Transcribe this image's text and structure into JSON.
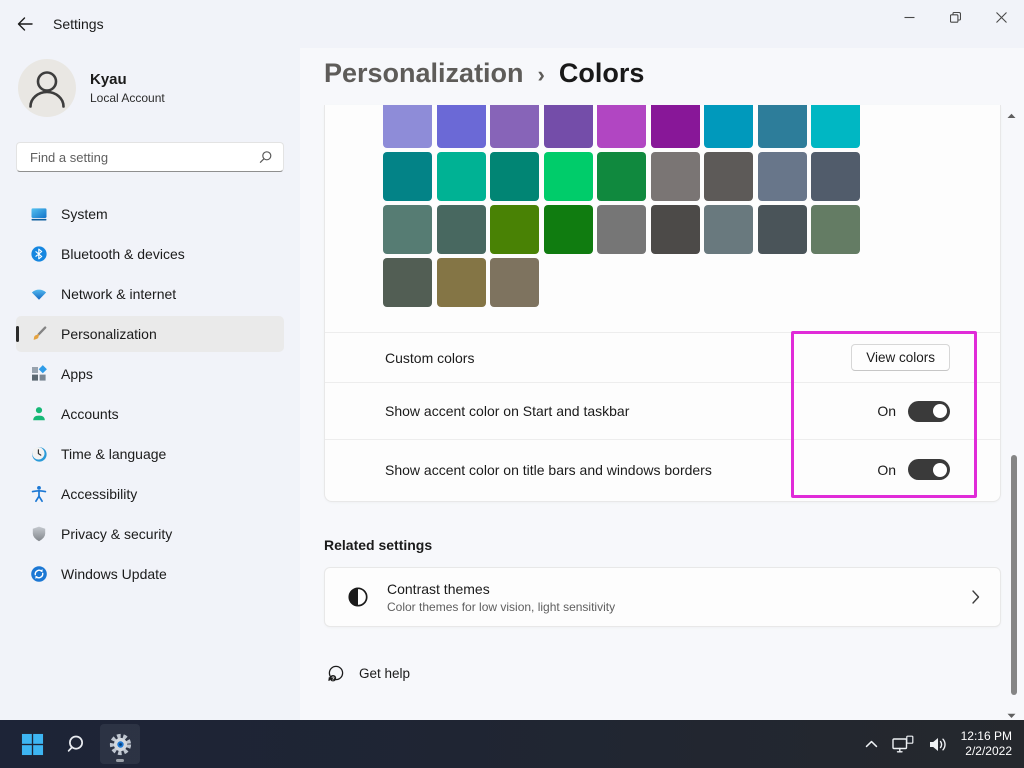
{
  "titlebar": {
    "title": "Settings"
  },
  "sidebar": {
    "user": {
      "name": "Kyau",
      "account_type": "Local Account"
    },
    "search_placeholder": "Find a setting",
    "items": [
      {
        "key": "system",
        "label": "System",
        "selected": false
      },
      {
        "key": "bluetooth",
        "label": "Bluetooth & devices",
        "selected": false
      },
      {
        "key": "network",
        "label": "Network & internet",
        "selected": false
      },
      {
        "key": "personalization",
        "label": "Personalization",
        "selected": true
      },
      {
        "key": "apps",
        "label": "Apps",
        "selected": false
      },
      {
        "key": "accounts",
        "label": "Accounts",
        "selected": false
      },
      {
        "key": "time",
        "label": "Time & language",
        "selected": false
      },
      {
        "key": "accessibility",
        "label": "Accessibility",
        "selected": false
      },
      {
        "key": "privacy",
        "label": "Privacy & security",
        "selected": false
      },
      {
        "key": "update",
        "label": "Windows Update",
        "selected": false
      }
    ]
  },
  "breadcrumb": {
    "parent": "Personalization",
    "separator": "›",
    "current": "Colors"
  },
  "accent_palette": {
    "colors": [
      "#8E8CD8",
      "#6B69D6",
      "#8764B8",
      "#744DA9",
      "#B146C2",
      "#881798",
      "#0099BC",
      "#2D7D9A",
      "#00B7C3",
      "#038387",
      "#00B294",
      "#018574",
      "#00CC6A",
      "#10893E",
      "#7A7574",
      "#5D5A58",
      "#68768A",
      "#515C6B",
      "#567C73",
      "#486860",
      "#498205",
      "#107C10",
      "#767676",
      "#4C4A48",
      "#69797E",
      "#4A5459",
      "#647C64",
      "#525E54",
      "#847545",
      "#7E735F"
    ]
  },
  "settings_rows": {
    "custom_colors": {
      "label": "Custom colors",
      "button_label": "View colors"
    },
    "accent_start": {
      "label": "Show accent color on Start and taskbar",
      "state": "On"
    },
    "accent_title": {
      "label": "Show accent color on title bars and windows borders",
      "state": "On"
    }
  },
  "related": {
    "heading": "Related settings",
    "contrast": {
      "title": "Contrast themes",
      "subtitle": "Color themes for low vision, light sensitivity"
    }
  },
  "help": {
    "label": "Get help"
  },
  "annotation": {
    "highlight_color": "#E02BD8"
  },
  "taskbar": {
    "clock": {
      "time": "12:16 PM",
      "date": "2/2/2022"
    }
  }
}
